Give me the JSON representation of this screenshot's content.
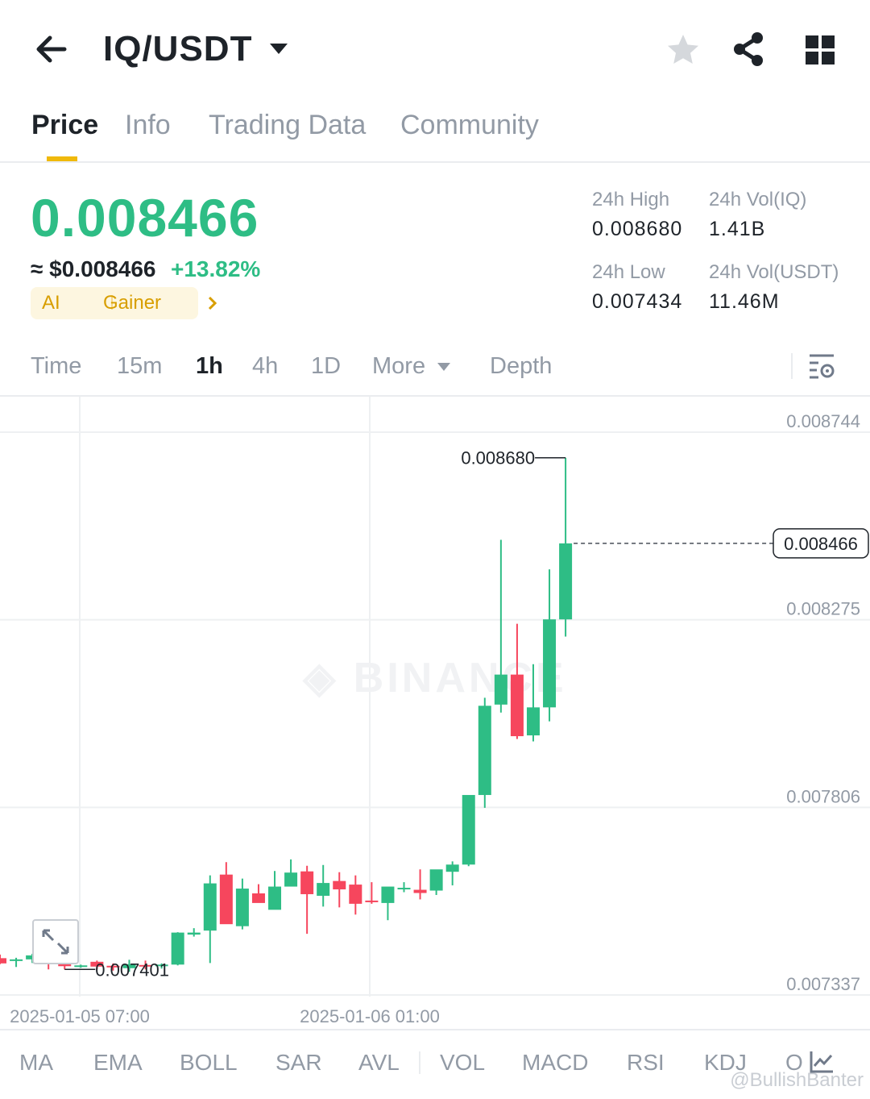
{
  "header": {
    "pair": "IQ/USDT",
    "back_icon": "arrow-left-icon",
    "favorite_icon": "star-icon",
    "share_icon": "share-icon",
    "layout_icon": "grid-icon"
  },
  "tabs": [
    {
      "label": "Price",
      "active": true
    },
    {
      "label": "Info",
      "active": false
    },
    {
      "label": "Trading Data",
      "active": false
    },
    {
      "label": "Community",
      "active": false
    }
  ],
  "price": {
    "last": "0.008466",
    "usd": "≈ $0.008466",
    "change": "+13.82%",
    "tag_ai": "AI",
    "tag_gainer": "Gainer"
  },
  "stats": {
    "high_label": "24h High",
    "high_value": "0.008680",
    "low_label": "24h Low",
    "low_value": "0.007434",
    "vol_base_label": "24h Vol(IQ)",
    "vol_base_value": "1.41B",
    "vol_quote_label": "24h Vol(USDT)",
    "vol_quote_value": "11.46M"
  },
  "intervals": [
    "Time",
    "15m",
    "1h",
    "4h",
    "1D",
    "More",
    "Depth"
  ],
  "active_interval": "1h",
  "colors": {
    "up": "#2ebd85",
    "down": "#f6465d",
    "accent": "#f0b90b"
  },
  "chart_data": {
    "type": "candlestick",
    "y_ticks": [
      "0.008744",
      "0.008275",
      "0.007806",
      "0.007337"
    ],
    "ylim": [
      0.0072,
      0.0088
    ],
    "x_ticks": [
      "2025-01-05 07:00",
      "2025-01-06 01:00"
    ],
    "last_price_label": "0.008466",
    "max_label": "0.008680",
    "min_label": "0.007401",
    "candles": [
      {
        "o": 0.007429,
        "h": 0.007438,
        "l": 0.007414,
        "c": 0.007416
      },
      {
        "o": 0.007422,
        "h": 0.00743,
        "l": 0.007407,
        "c": 0.007426
      },
      {
        "o": 0.007426,
        "h": 0.00744,
        "l": 0.007417,
        "c": 0.007436
      },
      {
        "o": 0.007436,
        "h": 0.007442,
        "l": 0.007401,
        "c": 0.007416
      },
      {
        "o": 0.007416,
        "h": 0.007426,
        "l": 0.007401,
        "c": 0.007409
      },
      {
        "o": 0.007409,
        "h": 0.007413,
        "l": 0.007405,
        "c": 0.007411
      },
      {
        "o": 0.00742,
        "h": 0.007423,
        "l": 0.007401,
        "c": 0.007408
      },
      {
        "o": 0.00741,
        "h": 0.007416,
        "l": 0.007398,
        "c": 0.007407
      },
      {
        "o": 0.007404,
        "h": 0.007425,
        "l": 0.007395,
        "c": 0.007414
      },
      {
        "o": 0.007412,
        "h": 0.007423,
        "l": 0.007401,
        "c": 0.007408
      },
      {
        "o": 0.007412,
        "h": 0.007416,
        "l": 0.007403,
        "c": 0.007413
      },
      {
        "o": 0.007413,
        "h": 0.007494,
        "l": 0.007411,
        "c": 0.007493
      },
      {
        "o": 0.007488,
        "h": 0.007504,
        "l": 0.007483,
        "c": 0.007493
      },
      {
        "o": 0.007498,
        "h": 0.007636,
        "l": 0.007417,
        "c": 0.007616
      },
      {
        "o": 0.007638,
        "h": 0.007669,
        "l": 0.007519,
        "c": 0.007514
      },
      {
        "o": 0.007509,
        "h": 0.007628,
        "l": 0.007501,
        "c": 0.007603
      },
      {
        "o": 0.007591,
        "h": 0.007614,
        "l": 0.007577,
        "c": 0.007567
      },
      {
        "o": 0.00755,
        "h": 0.007647,
        "l": 0.007593,
        "c": 0.007608
      },
      {
        "o": 0.007608,
        "h": 0.007676,
        "l": 0.007642,
        "c": 0.007643
      },
      {
        "o": 0.007646,
        "h": 0.00766,
        "l": 0.00749,
        "c": 0.007589
      },
      {
        "o": 0.007585,
        "h": 0.007662,
        "l": 0.007558,
        "c": 0.007617
      },
      {
        "o": 0.007622,
        "h": 0.007644,
        "l": 0.007556,
        "c": 0.007601
      },
      {
        "o": 0.007613,
        "h": 0.007636,
        "l": 0.007538,
        "c": 0.007565
      },
      {
        "o": 0.007573,
        "h": 0.007619,
        "l": 0.007565,
        "c": 0.00757
      },
      {
        "o": 0.007567,
        "h": 0.007582,
        "l": 0.007524,
        "c": 0.007608
      },
      {
        "o": 0.007602,
        "h": 0.007619,
        "l": 0.007594,
        "c": 0.007605
      },
      {
        "o": 0.0076,
        "h": 0.007651,
        "l": 0.007576,
        "c": 0.007592
      },
      {
        "o": 0.007598,
        "h": 0.007645,
        "l": 0.007587,
        "c": 0.007651
      },
      {
        "o": 0.007645,
        "h": 0.007671,
        "l": 0.007611,
        "c": 0.007663
      },
      {
        "o": 0.007663,
        "h": 0.007677,
        "l": 0.007659,
        "c": 0.007837
      },
      {
        "o": 0.007837,
        "h": 0.00808,
        "l": 0.007805,
        "c": 0.00806
      },
      {
        "o": 0.008063,
        "h": 0.008475,
        "l": 0.008043,
        "c": 0.008138
      },
      {
        "o": 0.008138,
        "h": 0.008265,
        "l": 0.007977,
        "c": 0.007984
      },
      {
        "o": 0.007986,
        "h": 0.008164,
        "l": 0.007971,
        "c": 0.008056
      },
      {
        "o": 0.008056,
        "h": 0.008401,
        "l": 0.008021,
        "c": 0.008276
      },
      {
        "o": 0.008276,
        "h": 0.00868,
        "l": 0.008233,
        "c": 0.008466
      }
    ]
  },
  "indicators": [
    "MA",
    "EMA",
    "BOLL",
    "SAR",
    "AVL",
    "VOL",
    "MACD",
    "RSI",
    "KDJ",
    "O"
  ],
  "watermark": "@BullishBanter"
}
